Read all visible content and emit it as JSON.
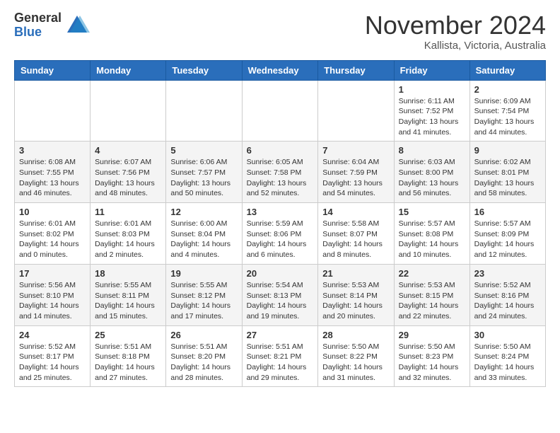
{
  "header": {
    "logo_general": "General",
    "logo_blue": "Blue",
    "month_title": "November 2024",
    "location": "Kallista, Victoria, Australia"
  },
  "days_of_week": [
    "Sunday",
    "Monday",
    "Tuesday",
    "Wednesday",
    "Thursday",
    "Friday",
    "Saturday"
  ],
  "weeks": [
    [
      {
        "day": "",
        "info": ""
      },
      {
        "day": "",
        "info": ""
      },
      {
        "day": "",
        "info": ""
      },
      {
        "day": "",
        "info": ""
      },
      {
        "day": "",
        "info": ""
      },
      {
        "day": "1",
        "info": "Sunrise: 6:11 AM\nSunset: 7:52 PM\nDaylight: 13 hours\nand 41 minutes."
      },
      {
        "day": "2",
        "info": "Sunrise: 6:09 AM\nSunset: 7:54 PM\nDaylight: 13 hours\nand 44 minutes."
      }
    ],
    [
      {
        "day": "3",
        "info": "Sunrise: 6:08 AM\nSunset: 7:55 PM\nDaylight: 13 hours\nand 46 minutes."
      },
      {
        "day": "4",
        "info": "Sunrise: 6:07 AM\nSunset: 7:56 PM\nDaylight: 13 hours\nand 48 minutes."
      },
      {
        "day": "5",
        "info": "Sunrise: 6:06 AM\nSunset: 7:57 PM\nDaylight: 13 hours\nand 50 minutes."
      },
      {
        "day": "6",
        "info": "Sunrise: 6:05 AM\nSunset: 7:58 PM\nDaylight: 13 hours\nand 52 minutes."
      },
      {
        "day": "7",
        "info": "Sunrise: 6:04 AM\nSunset: 7:59 PM\nDaylight: 13 hours\nand 54 minutes."
      },
      {
        "day": "8",
        "info": "Sunrise: 6:03 AM\nSunset: 8:00 PM\nDaylight: 13 hours\nand 56 minutes."
      },
      {
        "day": "9",
        "info": "Sunrise: 6:02 AM\nSunset: 8:01 PM\nDaylight: 13 hours\nand 58 minutes."
      }
    ],
    [
      {
        "day": "10",
        "info": "Sunrise: 6:01 AM\nSunset: 8:02 PM\nDaylight: 14 hours\nand 0 minutes."
      },
      {
        "day": "11",
        "info": "Sunrise: 6:01 AM\nSunset: 8:03 PM\nDaylight: 14 hours\nand 2 minutes."
      },
      {
        "day": "12",
        "info": "Sunrise: 6:00 AM\nSunset: 8:04 PM\nDaylight: 14 hours\nand 4 minutes."
      },
      {
        "day": "13",
        "info": "Sunrise: 5:59 AM\nSunset: 8:06 PM\nDaylight: 14 hours\nand 6 minutes."
      },
      {
        "day": "14",
        "info": "Sunrise: 5:58 AM\nSunset: 8:07 PM\nDaylight: 14 hours\nand 8 minutes."
      },
      {
        "day": "15",
        "info": "Sunrise: 5:57 AM\nSunset: 8:08 PM\nDaylight: 14 hours\nand 10 minutes."
      },
      {
        "day": "16",
        "info": "Sunrise: 5:57 AM\nSunset: 8:09 PM\nDaylight: 14 hours\nand 12 minutes."
      }
    ],
    [
      {
        "day": "17",
        "info": "Sunrise: 5:56 AM\nSunset: 8:10 PM\nDaylight: 14 hours\nand 14 minutes."
      },
      {
        "day": "18",
        "info": "Sunrise: 5:55 AM\nSunset: 8:11 PM\nDaylight: 14 hours\nand 15 minutes."
      },
      {
        "day": "19",
        "info": "Sunrise: 5:55 AM\nSunset: 8:12 PM\nDaylight: 14 hours\nand 17 minutes."
      },
      {
        "day": "20",
        "info": "Sunrise: 5:54 AM\nSunset: 8:13 PM\nDaylight: 14 hours\nand 19 minutes."
      },
      {
        "day": "21",
        "info": "Sunrise: 5:53 AM\nSunset: 8:14 PM\nDaylight: 14 hours\nand 20 minutes."
      },
      {
        "day": "22",
        "info": "Sunrise: 5:53 AM\nSunset: 8:15 PM\nDaylight: 14 hours\nand 22 minutes."
      },
      {
        "day": "23",
        "info": "Sunrise: 5:52 AM\nSunset: 8:16 PM\nDaylight: 14 hours\nand 24 minutes."
      }
    ],
    [
      {
        "day": "24",
        "info": "Sunrise: 5:52 AM\nSunset: 8:17 PM\nDaylight: 14 hours\nand 25 minutes."
      },
      {
        "day": "25",
        "info": "Sunrise: 5:51 AM\nSunset: 8:18 PM\nDaylight: 14 hours\nand 27 minutes."
      },
      {
        "day": "26",
        "info": "Sunrise: 5:51 AM\nSunset: 8:20 PM\nDaylight: 14 hours\nand 28 minutes."
      },
      {
        "day": "27",
        "info": "Sunrise: 5:51 AM\nSunset: 8:21 PM\nDaylight: 14 hours\nand 29 minutes."
      },
      {
        "day": "28",
        "info": "Sunrise: 5:50 AM\nSunset: 8:22 PM\nDaylight: 14 hours\nand 31 minutes."
      },
      {
        "day": "29",
        "info": "Sunrise: 5:50 AM\nSunset: 8:23 PM\nDaylight: 14 hours\nand 32 minutes."
      },
      {
        "day": "30",
        "info": "Sunrise: 5:50 AM\nSunset: 8:24 PM\nDaylight: 14 hours\nand 33 minutes."
      }
    ]
  ]
}
